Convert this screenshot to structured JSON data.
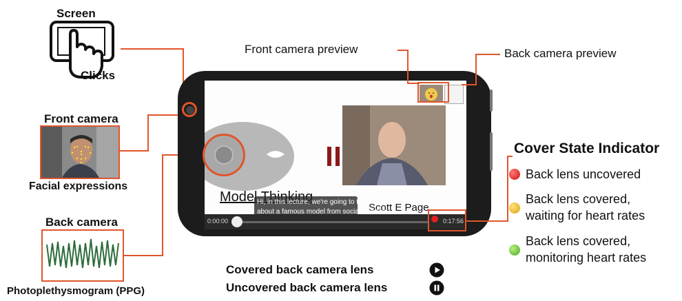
{
  "labels": {
    "screen_title": "Screen",
    "screen_sub": "Clicks",
    "front_camera_title": "Front camera",
    "front_camera_sub": "Facial expressions",
    "back_camera_title": "Back camera",
    "back_camera_sub": "Photoplethysmogram (PPG)",
    "front_preview": "Front camera preview",
    "back_preview": "Back camera preview"
  },
  "player": {
    "slide_title": "Model Thinking",
    "presenter": "Scott  E Page",
    "caption_line1": "Hi, in this lecture, we're going to talk",
    "caption_line2": "about a famous model from social science",
    "time_current": "0:00:00",
    "time_total": "0:17:56"
  },
  "indicator": {
    "title": "Cover State Indicator",
    "items": [
      {
        "color": "#e02020",
        "line1": "Back lens uncovered",
        "line2": ""
      },
      {
        "color": "#f2b81e",
        "line1": "Back lens covered,",
        "line2": "waiting for heart rates"
      },
      {
        "color": "#6cc437",
        "line1": "Back lens covered,",
        "line2": "monitoring heart rates"
      }
    ]
  },
  "bottom": {
    "covered": "Covered back camera lens",
    "uncovered": "Uncovered back camera lens"
  },
  "colors": {
    "accent": "#e0552b",
    "ppg": "#2b6d3a"
  }
}
